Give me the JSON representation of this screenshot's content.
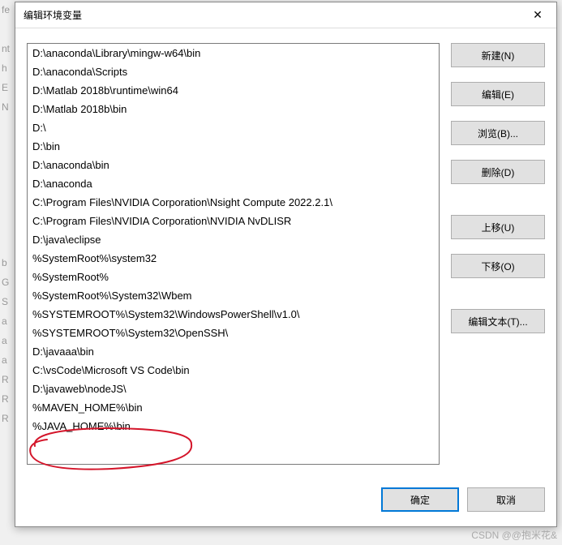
{
  "titlebar": {
    "title": "编辑环境变量"
  },
  "listbox": {
    "items": [
      "D:\\anaconda\\Library\\mingw-w64\\bin",
      "D:\\anaconda\\Scripts",
      "D:\\Matlab 2018b\\runtime\\win64",
      "D:\\Matlab 2018b\\bin",
      "D:\\",
      "D:\\bin",
      "D:\\anaconda\\bin",
      "D:\\anaconda",
      "C:\\Program Files\\NVIDIA Corporation\\Nsight Compute 2022.2.1\\",
      "C:\\Program Files\\NVIDIA Corporation\\NVIDIA NvDLISR",
      "D:\\java\\eclipse",
      "%SystemRoot%\\system32",
      "%SystemRoot%",
      "%SystemRoot%\\System32\\Wbem",
      "%SYSTEMROOT%\\System32\\WindowsPowerShell\\v1.0\\",
      "%SYSTEMROOT%\\System32\\OpenSSH\\",
      "D:\\javaaa\\bin",
      "C:\\vsCode\\Microsoft VS Code\\bin",
      "D:\\javaweb\\nodeJS\\",
      "%MAVEN_HOME%\\bin",
      "%JAVA_HOME%\\bin"
    ]
  },
  "buttons": {
    "new": "新建(N)",
    "edit": "编辑(E)",
    "browse": "浏览(B)...",
    "delete": "删除(D)",
    "moveup": "上移(U)",
    "movedown": "下移(O)",
    "edittext": "编辑文本(T)...",
    "ok": "确定",
    "cancel": "取消"
  },
  "watermark": "CSDN @@抱米花&",
  "bg": "fe\n\nnt\nh\nE\nN\n\n\n\n\n\n\n\nb\nG\nS\na\na\na\nR\nR\nR"
}
